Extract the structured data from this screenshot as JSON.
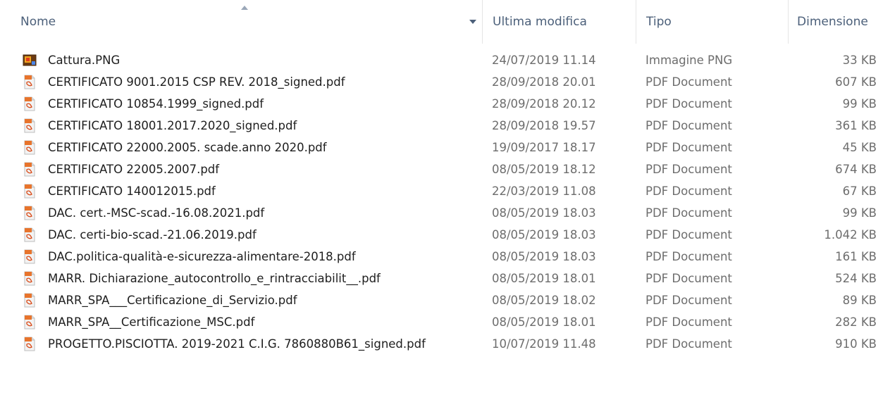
{
  "columns": {
    "name": "Nome",
    "modified": "Ultima modifica",
    "type": "Tipo",
    "size": "Dimensione"
  },
  "files": [
    {
      "name": "Cattura.PNG",
      "modified": "24/07/2019 11.14",
      "type": "Immagine PNG",
      "size": "33 KB",
      "icon": "png-image-icon"
    },
    {
      "name": "CERTIFICATO 9001.2015 CSP REV. 2018_signed.pdf",
      "modified": "28/09/2018 20.01",
      "type": "PDF Document",
      "size": "607 KB",
      "icon": "pdf-file-icon"
    },
    {
      "name": "CERTIFICATO 10854.1999_signed.pdf",
      "modified": "28/09/2018 20.12",
      "type": "PDF Document",
      "size": "99 KB",
      "icon": "pdf-file-icon"
    },
    {
      "name": "CERTIFICATO 18001.2017.2020_signed.pdf",
      "modified": "28/09/2018 19.57",
      "type": "PDF Document",
      "size": "361 KB",
      "icon": "pdf-file-icon"
    },
    {
      "name": "CERTIFICATO 22000.2005. scade.anno 2020.pdf",
      "modified": "19/09/2017 18.17",
      "type": "PDF Document",
      "size": "45 KB",
      "icon": "pdf-file-icon"
    },
    {
      "name": "CERTIFICATO 22005.2007.pdf",
      "modified": "08/05/2019 18.12",
      "type": "PDF Document",
      "size": "674 KB",
      "icon": "pdf-file-icon"
    },
    {
      "name": "CERTIFICATO 140012015.pdf",
      "modified": "22/03/2019 11.08",
      "type": "PDF Document",
      "size": "67 KB",
      "icon": "pdf-file-icon"
    },
    {
      "name": "DAC. cert.-MSC-scad.-16.08.2021.pdf",
      "modified": "08/05/2019 18.03",
      "type": "PDF Document",
      "size": "99 KB",
      "icon": "pdf-file-icon"
    },
    {
      "name": "DAC. certi-bio-scad.-21.06.2019.pdf",
      "modified": "08/05/2019 18.03",
      "type": "PDF Document",
      "size": "1.042 KB",
      "icon": "pdf-file-icon"
    },
    {
      "name": "DAC.politica-qualità-e-sicurezza-alimentare-2018.pdf",
      "modified": "08/05/2019 18.03",
      "type": "PDF Document",
      "size": "161 KB",
      "icon": "pdf-file-icon"
    },
    {
      "name": "MARR. Dichiarazione_autocontrollo_e_rintracciabilit__.pdf",
      "modified": "08/05/2019 18.01",
      "type": "PDF Document",
      "size": "524 KB",
      "icon": "pdf-file-icon"
    },
    {
      "name": "MARR_SPA___Certificazione_di_Servizio.pdf",
      "modified": "08/05/2019 18.02",
      "type": "PDF Document",
      "size": "89 KB",
      "icon": "pdf-file-icon"
    },
    {
      "name": "MARR_SPA__Certificazione_MSC.pdf",
      "modified": "08/05/2019 18.01",
      "type": "PDF Document",
      "size": "282 KB",
      "icon": "pdf-file-icon"
    },
    {
      "name": "PROGETTO.PISCIOTTA. 2019-2021 C.I.G. 7860880B61_signed.pdf",
      "modified": "10/07/2019 11.48",
      "type": "PDF Document",
      "size": "910 KB",
      "icon": "pdf-file-icon"
    }
  ]
}
